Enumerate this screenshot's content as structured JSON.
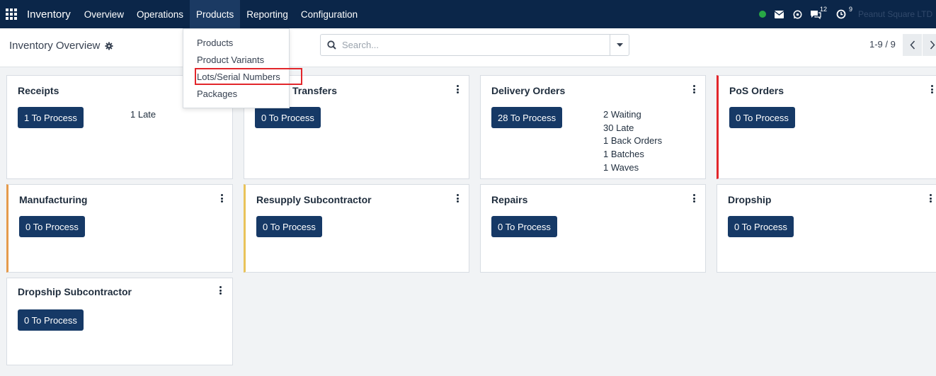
{
  "app": {
    "name": "Inventory"
  },
  "nav": [
    "Overview",
    "Operations",
    "Products",
    "Reporting",
    "Configuration"
  ],
  "systray": {
    "messages_count": "12",
    "activities_count": "9",
    "company": "Peanut Square LTD"
  },
  "control": {
    "title": "Inventory Overview",
    "search_placeholder": "Search...",
    "pager": "1-9 / 9"
  },
  "products_menu": [
    "Products",
    "Product Variants",
    "Lots/Serial Numbers",
    "Packages"
  ],
  "cards": [
    {
      "title": "Receipts",
      "button": "1 To Process",
      "stats": [
        "1 Late"
      ]
    },
    {
      "title": "Transfers",
      "button": "0 To Process",
      "stats": []
    },
    {
      "title": "Delivery Orders",
      "button": "28 To Process",
      "stats": [
        "2 Waiting",
        "30 Late",
        "1 Back Orders",
        "1 Batches",
        "1 Waves"
      ]
    },
    {
      "title": "PoS Orders",
      "button": "0 To Process",
      "stats": []
    },
    {
      "title": "Manufacturing",
      "button": "0 To Process",
      "stats": []
    },
    {
      "title": "Resupply Subcontractor",
      "button": "0 To Process",
      "stats": []
    },
    {
      "title": "Repairs",
      "button": "0 To Process",
      "stats": []
    },
    {
      "title": "Dropship",
      "button": "0 To Process",
      "stats": []
    },
    {
      "title": "Dropship Subcontractor",
      "button": "0 To Process",
      "stats": []
    }
  ]
}
